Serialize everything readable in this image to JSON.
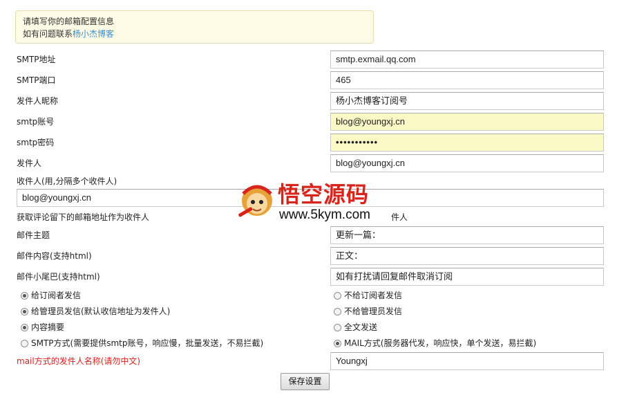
{
  "notice": {
    "line1": "请填写你的邮箱配置信息",
    "line2_prefix": "如有问题联系",
    "line2_link": "杨小杰博客"
  },
  "fields": {
    "smtp_address": {
      "label": "SMTP地址",
      "value": "smtp.exmail.qq.com"
    },
    "smtp_port": {
      "label": "SMTP端口",
      "value": "465"
    },
    "sender_nickname": {
      "label": "发件人昵称",
      "value": "杨小杰博客订阅号"
    },
    "smtp_account": {
      "label": "smtp账号",
      "value": "blog@youngxj.cn"
    },
    "smtp_password": {
      "label": "smtp密码",
      "value": "•••••••••••"
    },
    "sender": {
      "label": "发件人",
      "value": "blog@youngxj.cn"
    },
    "recipients": {
      "label": "收件人(用,分隔多个收件人)",
      "value": "blog@youngxj.cn"
    },
    "subject": {
      "label": "邮件主题",
      "value": "更新一篇："
    },
    "content": {
      "label": "邮件内容(支持html)",
      "value": "正文："
    },
    "footer": {
      "label": "邮件小尾巴(支持html)",
      "value": "如有打扰请回复邮件取消订阅"
    },
    "mail_sender_name": {
      "label": "mail方式的发件人名称(请勿中文)",
      "value": "Youngxj"
    }
  },
  "comment_option": {
    "left": "获取评论留下的邮箱地址作为收件人",
    "right_partial": "件人"
  },
  "radios": {
    "send_subscribers": {
      "label": "给订阅者发信",
      "checked": true
    },
    "no_send_subscribers": {
      "label": "不给订阅者发信",
      "checked": false
    },
    "send_admin": {
      "label": "给管理员发信(默认收信地址为发件人)",
      "checked": true
    },
    "no_send_admin": {
      "label": "不给管理员发信",
      "checked": false
    },
    "summary": {
      "label": "内容摘要",
      "checked": true
    },
    "fulltext": {
      "label": "全文发送",
      "checked": false
    },
    "smtp_mode": {
      "label": "SMTP方式(需要提供smtp账号，响应慢，批量发送，不易拦截)",
      "checked": false
    },
    "mail_mode": {
      "label": "MAIL方式(服务器代发，响应快，单个发送，易拦截)",
      "checked": true
    }
  },
  "save_button": "保存设置",
  "watermark": {
    "title": "悟空源码",
    "url": "www.5kym.com"
  },
  "colors": {
    "warning_text": "#d6201e",
    "link": "#3a8fd0",
    "autofill": "#fbf9c6"
  }
}
